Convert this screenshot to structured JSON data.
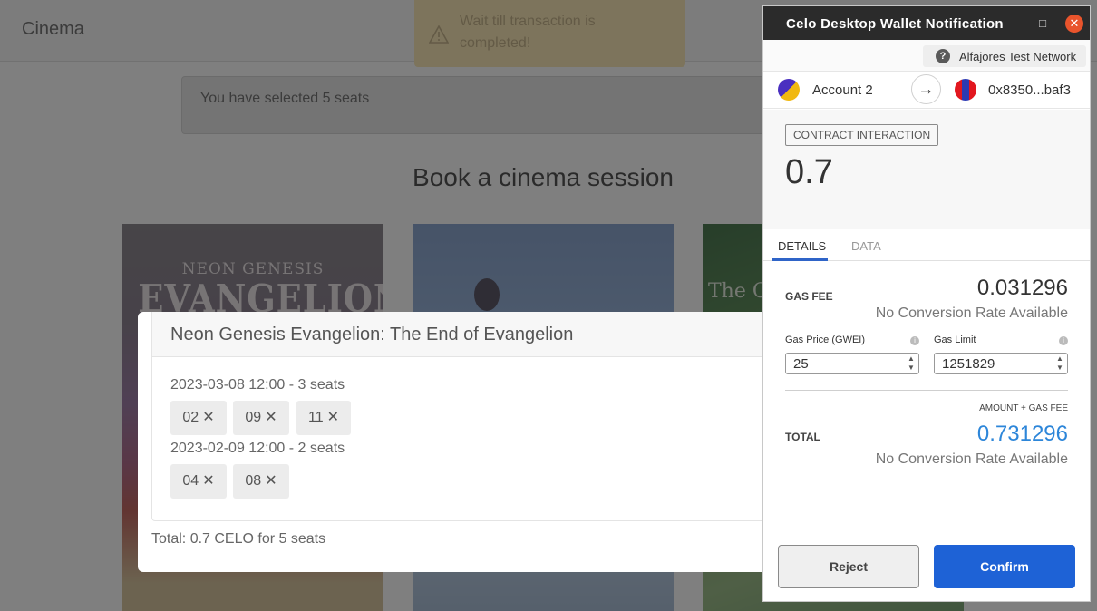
{
  "app": {
    "brand": "Cinema",
    "toast_text": "Wait till transaction is completed!",
    "alert_text": "You have selected 5 seats",
    "page_heading": "Book a cinema session",
    "posters": [
      {
        "title_line1": "NEON GENESIS",
        "title_line2": "EVANGELION"
      },
      {
        "title": ""
      },
      {
        "title": "The C"
      }
    ]
  },
  "modal": {
    "title": "Neon Genesis Evangelion: The End of Evangelion",
    "sessions": [
      {
        "label": "2023-03-08 12:00 - 3 seats",
        "seats": [
          "02",
          "09",
          "11"
        ]
      },
      {
        "label": "2023-02-09 12:00 - 2 seats",
        "seats": [
          "04",
          "08"
        ]
      }
    ],
    "remove_glyph": "✕",
    "total_text": "Total: 0.7 CELO for 5 seats"
  },
  "wallet": {
    "window_title": "Celo Desktop Wallet Notification",
    "minimize_glyph": "–",
    "maximize_glyph": "□",
    "close_glyph": "✕",
    "network": "Alfajores Test Network",
    "help_glyph": "?",
    "from_account": "Account 2",
    "arrow_glyph": "→",
    "to_address": "0x8350...baf3",
    "type_badge": "CONTRACT INTERACTION",
    "amount": "0.7",
    "tabs": [
      {
        "label": "DETAILS",
        "active": true
      },
      {
        "label": "DATA",
        "active": false
      }
    ],
    "gas_fee_label": "GAS FEE",
    "gas_fee_value": "0.031296",
    "no_conversion": "No Conversion Rate Available",
    "gas_price_label": "Gas Price (GWEI)",
    "gas_price_value": "25",
    "gas_limit_label": "Gas Limit",
    "gas_limit_value": "1251829",
    "info_glyph": "i",
    "amount_gas_label": "AMOUNT + GAS FEE",
    "total_label": "TOTAL",
    "total_value": "0.731296",
    "reject_label": "Reject",
    "confirm_label": "Confirm"
  },
  "colors": {
    "confirm": "#1e62d6",
    "total_value": "#2d86d9",
    "titlebar": "#2b2b2b",
    "close": "#e9542c",
    "toast": "#fbe9b8"
  }
}
